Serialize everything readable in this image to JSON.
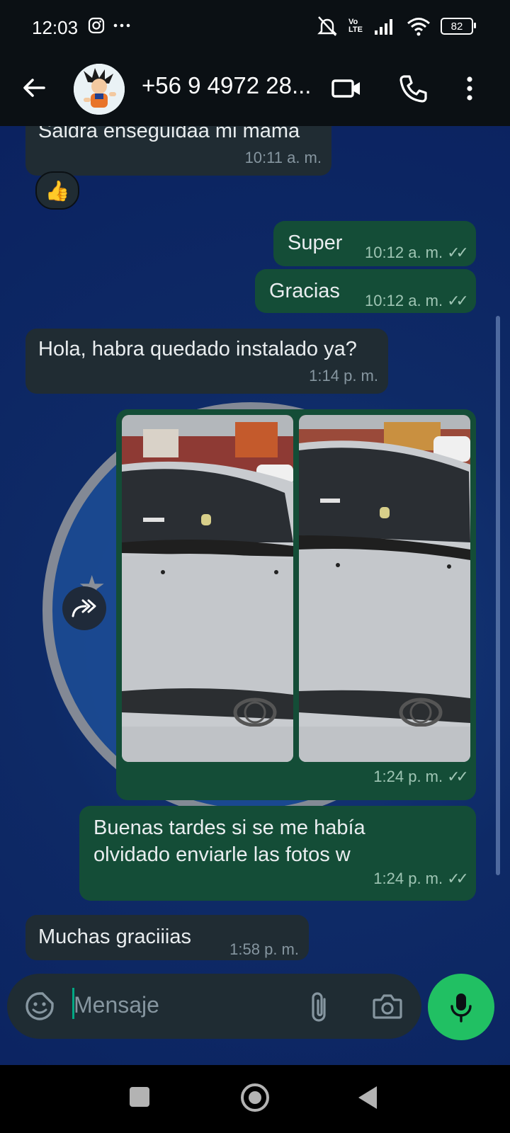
{
  "status_bar": {
    "time": "12:03",
    "icons_left": [
      "instagram-icon",
      "more-dots-icon"
    ],
    "icons_right": [
      "mute-icon",
      "volte-icon",
      "signal-icon",
      "wifi-icon",
      "battery-icon"
    ],
    "volte_text": "Vo LTE",
    "battery": "82"
  },
  "header": {
    "contact_name": "+56 9 4972 28...",
    "icons": [
      "back-arrow-icon",
      "video-call-icon",
      "voice-call-icon",
      "menu-icon"
    ]
  },
  "messages": [
    {
      "direction": "in",
      "text": "Saldra enseguidaa mi mama",
      "time": "10:11 a. m.",
      "reaction": "👍"
    },
    {
      "direction": "out",
      "text": "Super",
      "time": "10:12 a. m.",
      "ticks": "✓✓"
    },
    {
      "direction": "out",
      "text": "Gracias",
      "time": "10:12 a. m.",
      "ticks": "✓✓"
    },
    {
      "direction": "in",
      "text": "Hola, habra quedado instalado ya?",
      "time": "1:14 p. m."
    },
    {
      "direction": "out",
      "type": "photos",
      "time": "1:24 p. m.",
      "ticks": "✓✓"
    },
    {
      "direction": "out",
      "text": "Buenas tardes si se me había olvidado enviarle las fotos w",
      "time": "1:24 p. m.",
      "ticks": "✓✓"
    },
    {
      "direction": "in",
      "text": "Muchas graciiias",
      "time": "1:58 p. m."
    }
  ],
  "composer": {
    "placeholder": "Mensaje",
    "icons": [
      "sticker-icon",
      "attach-icon",
      "camera-icon",
      "mic-icon"
    ]
  },
  "colors": {
    "incoming_bubble": "#202c33",
    "outgoing_bubble": "#144d37",
    "accent": "#21c063",
    "wallpaper": "#0e2a66"
  }
}
